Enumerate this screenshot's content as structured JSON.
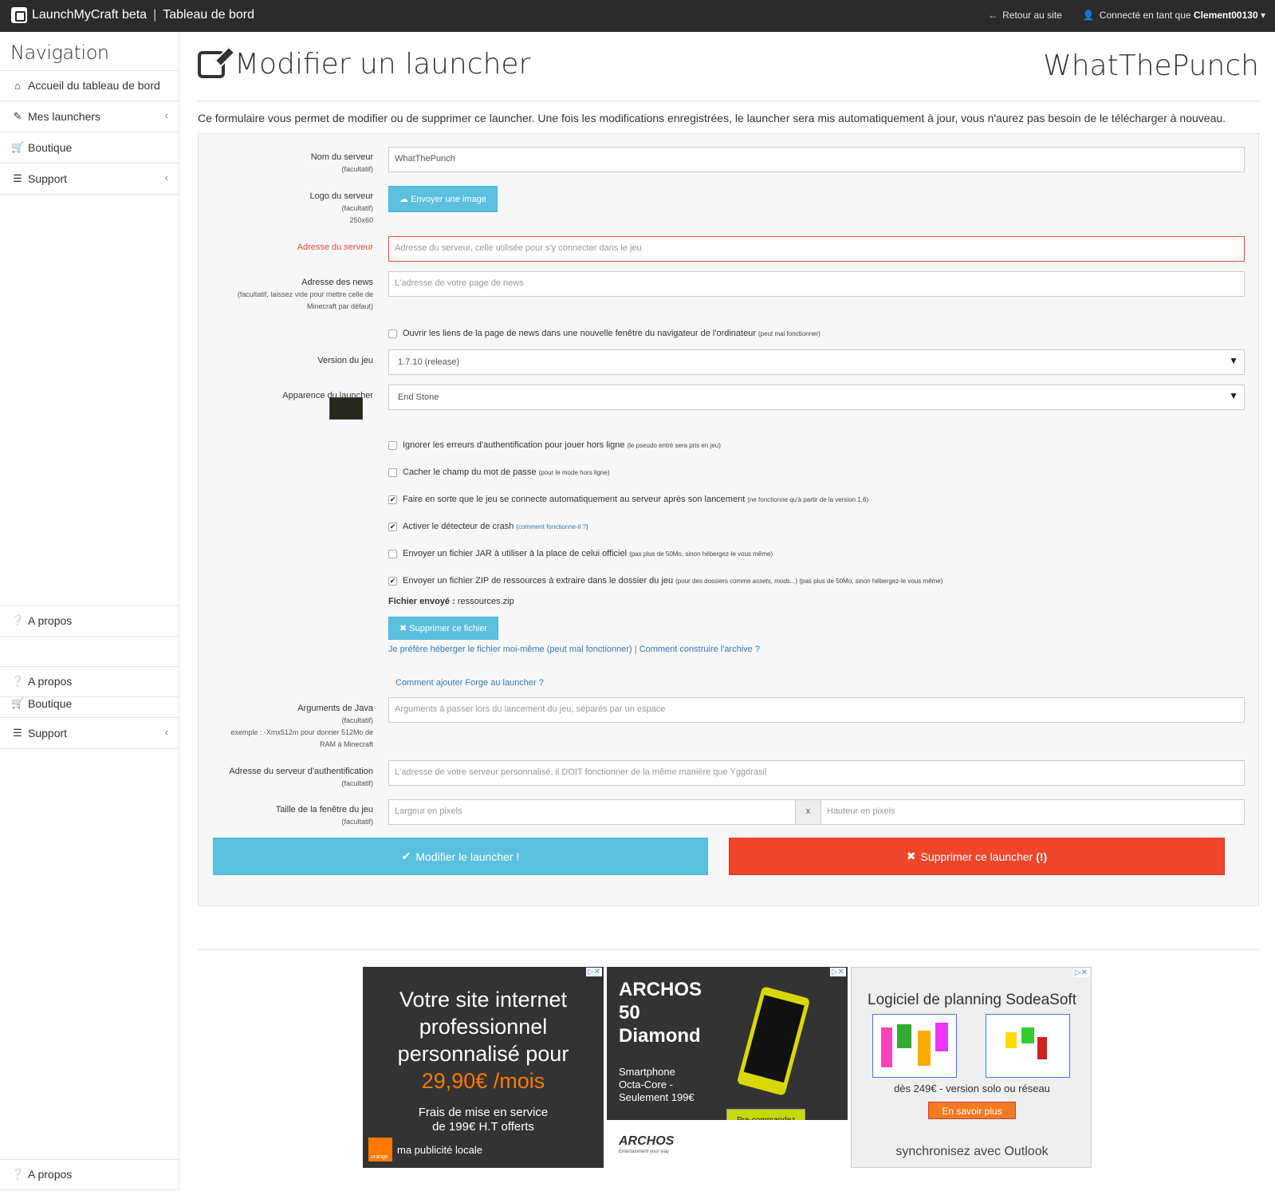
{
  "topbar": {
    "brand": "LaunchMyCraft beta",
    "section": "Tableau de bord",
    "back_label": "Retour au site",
    "connected_prefix": "Connecté en tant que",
    "username": "Clement00130"
  },
  "sidebar": {
    "title": "Navigation",
    "items": [
      {
        "label": "Accueil du tableau de bord"
      },
      {
        "label": "Mes launchers"
      },
      {
        "label": "Boutique"
      },
      {
        "label": "Support"
      },
      {
        "label": "A propos"
      },
      {
        "label": "A propos"
      },
      {
        "label": "Boutique"
      },
      {
        "label": "Support"
      },
      {
        "label": "A propos"
      }
    ]
  },
  "page": {
    "title": "Modifier un launcher",
    "server_name": "WhatThePunch",
    "intro": "Ce formulaire vous permet de modifier ou de supprimer ce launcher. Une fois les modifications enregistrées, le launcher sera mis automatiquement à jour, vous n'aurez pas besoin de le télécharger à nouveau."
  },
  "form": {
    "server_name_label": "Nom du serveur",
    "optional": "(facultatif)",
    "server_name_value": "WhatThePunch",
    "logo_label": "Logo du serveur",
    "logo_size": "250x60",
    "upload_button": "Envoyer une image",
    "address_label": "Adresse du serveur",
    "address_placeholder": "Adresse du serveur, celle utilisée pour s'y connecter dans le jeu",
    "news_label": "Adresse des news",
    "news_sub": "(facultatif, laissez vide pour mettre celle de Minecraft par défaut)",
    "news_placeholder": "L'adresse de votre page de news",
    "news_newwindow": "Ouvrir les liens de la page de news dans une nouvelle fenêtre du navigateur de l'ordinateur",
    "news_newwindow_note": "(peut mal fonctionner)",
    "version_label": "Version du jeu",
    "version_value": "1.7.10 (release)",
    "appearance_label": "Apparence du launcher",
    "appearance_value": "End Stone",
    "opt_ignore_auth": "Ignorer les erreurs d'authentification pour jouer hors ligne",
    "opt_ignore_auth_note": "(le pseudo entré sera pris en jeu)",
    "opt_hide_pw": "Cacher le champ du mot de passe",
    "opt_hide_pw_note": "(pour le mode hors ligne)",
    "opt_autoconnect": "Faire en sorte que le jeu se connecte automatiquement au serveur après son lancement",
    "opt_autoconnect_note": "(ne fonctionne qu'à partir de la version 1.6)",
    "opt_crash": "Activer le détecteur de crash",
    "opt_crash_link": "comment fonctionne-il ?",
    "opt_jar": "Envoyer un fichier JAR à utiliser à la place de celui officiel",
    "opt_jar_note": "(pas plus de 50Mo, sinon hébergez-le vous même)",
    "opt_zip": "Envoyer un fichier ZIP de ressources à extraire dans le dossier du jeu",
    "opt_zip_note1": "(pour des dossiers comme",
    "opt_zip_note2": "assets, mods...",
    "opt_zip_note3": ") (pas plus de 50Mo, sinon hébergez-le vous même)",
    "sent_file_label": "Fichier envoyé :",
    "sent_file_name": "ressources.zip",
    "delete_file_button": "Supprimer ce fichier",
    "host_self_link": "Je préfère héberger le fichier moi-même (peut mal fonctionner)",
    "build_archive_link": "Comment construire l'archive ?",
    "forge_link": "Comment ajouter Forge au launcher ?",
    "java_label": "Arguments de Java",
    "java_example": "exemple : -Xmx512m pour donner 512Mo de RAM à Minecraft",
    "java_placeholder": "Arguments à passer lors du lancement du jeu, séparés par un espace",
    "auth_label": "Adresse du serveur d'authentification",
    "auth_placeholder": "L'adresse de votre serveur personnalisé, il DOIT fonctionner de la même manière que Yggdrasil",
    "window_label": "Taille de la fenêtre du jeu",
    "width_placeholder": "Largeur en pixels",
    "x_sep": "x",
    "height_placeholder": "Hauteur en pixels",
    "submit_button": "Modifier le launcher !",
    "delete_button": "Supprimer ce launcher",
    "delete_warn": "(!)"
  },
  "checkboxes": {
    "news_newwindow": false,
    "ignore_auth": false,
    "hide_pw": false,
    "autoconnect": true,
    "crash": true,
    "jar": false,
    "zip": true
  },
  "ads": [
    {
      "line1": "Votre site internet",
      "line2": "professionnel",
      "line3": "personnalisé pour",
      "price": "29,90€ /mois",
      "line4": "Frais de mise en service",
      "line5": "de 199€ H.T offerts",
      "footer": "ma publicité locale",
      "brand": "orange"
    },
    {
      "title1": "ARCHOS",
      "title2": "50",
      "title3": "Diamond",
      "desc1": "Smartphone",
      "desc2": "Octa-Core -",
      "desc3": "Seulement 199€",
      "cta": "Pre-commandez",
      "brand": "ARCHOS",
      "tagline": "Entertainment your way"
    },
    {
      "title": "Logiciel de planning SodeaSoft",
      "price": "dès 249€ - version solo ou réseau",
      "cta": "En savoir plus",
      "footer": "synchronisez avec Outlook"
    }
  ],
  "colors": {
    "accent": "#5bc0de",
    "danger": "#f0452a",
    "topbar": "#2b2b2b"
  }
}
